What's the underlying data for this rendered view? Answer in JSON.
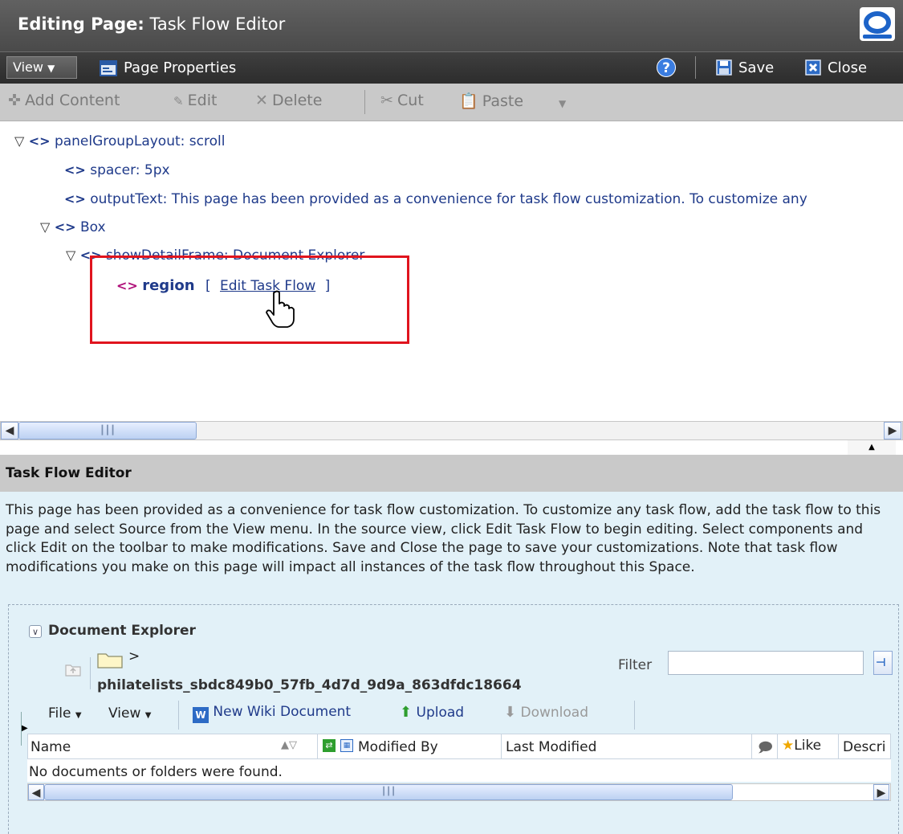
{
  "window": {
    "title_prefix": "Editing Page:",
    "title_name": "Task Flow Editor"
  },
  "menubar": {
    "view_label": "View",
    "page_properties_label": "Page Properties",
    "save_label": "Save",
    "close_label": "Close"
  },
  "toolbar": {
    "add_content_label": "Add Content",
    "edit_label": "Edit",
    "delete_label": "Delete",
    "cut_label": "Cut",
    "paste_label": "Paste"
  },
  "tree": {
    "items": [
      {
        "label": "panelGroupLayout: scroll"
      },
      {
        "label": "spacer: 5px"
      },
      {
        "label": "outputText: This page has been provided as a convenience for task flow customization. To customize any"
      },
      {
        "label": "Box"
      },
      {
        "label": "showDetailFrame: Document Explorer"
      },
      {
        "label": "region"
      }
    ],
    "edit_task_flow_link": "Edit Task Flow",
    "bracket_open": "[",
    "bracket_close": "]"
  },
  "task_flow_editor": {
    "title": "Task Flow Editor",
    "description": "This page has been provided as a convenience for task flow customization. To customize any task flow, add the task flow to this page and select Source from the View menu. In the source view, click Edit Task Flow to begin editing. Select components and click Edit on the toolbar to make modifications. Save and Close the page to save your customizations. Note that task flow modifications you make on this page will impact all instances of the task flow throughout this Space."
  },
  "document_explorer": {
    "title": "Document Explorer",
    "breadcrumb_sep": ">",
    "folder_name": "philatelists_sbdc849b0_57fb_4d7d_9d9a_863dfdc18664",
    "filter_label": "Filter",
    "filter_value": "",
    "menu": {
      "file_label": "File",
      "view_label": "View",
      "new_wiki_label": "New Wiki Document",
      "upload_label": "Upload",
      "download_label": "Download"
    },
    "columns": {
      "name": "Name",
      "modified_by": "Modified By",
      "last_modified": "Last Modified",
      "like": "Like",
      "description": "Descri"
    },
    "empty_message": "No documents or folders were found."
  },
  "colors": {
    "title_bar": "#4f4f4f",
    "toolbar": "#c9c9c9",
    "link": "#1f3a8a",
    "highlight_box": "#e0141e",
    "region_tag": "#b0117a",
    "panel_bg": "#e2f1f8"
  }
}
